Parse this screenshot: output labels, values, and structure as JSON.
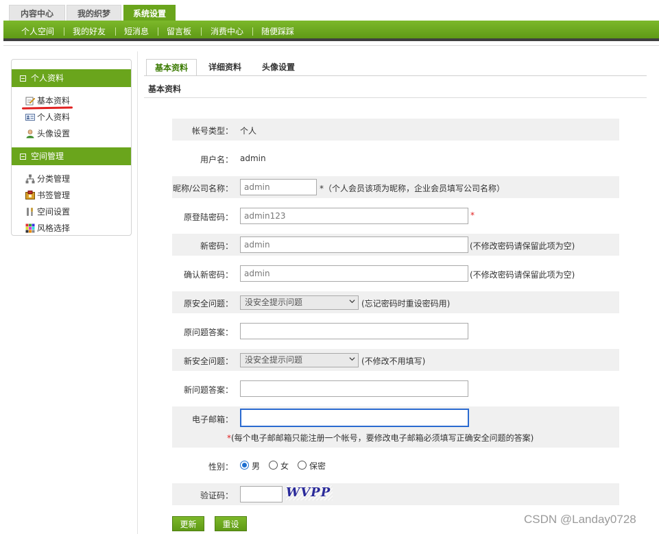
{
  "top_tabs": [
    "内容中心",
    "我的织梦",
    "系统设置"
  ],
  "subnav": [
    "个人空间",
    "我的好友",
    "短消息",
    "留言板",
    "消费中心",
    "随便踩踩"
  ],
  "sidebar": {
    "group1": "个人资料",
    "group1_items": [
      "基本资料",
      "个人资料",
      "头像设置"
    ],
    "group2": "空间管理",
    "group2_items": [
      "分类管理",
      "书签管理",
      "空间设置",
      "风格选择"
    ]
  },
  "content_tabs": [
    "基本资料",
    "详细资料",
    "头像设置"
  ],
  "section_title": "基本资料",
  "form": {
    "account_type_label": "帐号类型：",
    "account_type_value": "个人",
    "username_label": "用户名：",
    "username_value": "admin",
    "nickname_label": "昵称/公司名称：",
    "nickname_value": "admin",
    "nickname_hint": "*（个人会员该项为昵称，企业会员填写公司名称）",
    "old_password_label": "原登陆密码：",
    "old_password_value": "admin123",
    "required_mark": "*",
    "new_password_label": "新密码：",
    "new_password_value": "admin",
    "new_password_hint": "(不修改密码请保留此项为空)",
    "confirm_password_label": "确认新密码：",
    "confirm_password_value": "admin",
    "confirm_password_hint": "(不修改密码请保留此项为空)",
    "old_question_label": "原安全问题：",
    "old_question_value": "没安全提示问题",
    "old_question_hint": "(忘记密码时重设密码用)",
    "old_answer_label": "原问题答案：",
    "old_answer_value": "",
    "new_question_label": "新安全问题：",
    "new_question_value": "没安全提示问题",
    "new_question_hint": "(不修改不用填写)",
    "new_answer_label": "新问题答案：",
    "new_answer_value": "",
    "email_label": "电子邮箱：",
    "email_value": "",
    "email_hint": "(每个电子邮邮箱只能注册一个帐号，要修改电子邮箱必须填写正确安全问题的答案)",
    "gender_label": "性别：",
    "gender_options": [
      "男",
      "女",
      "保密"
    ],
    "gender_selected": "男",
    "captcha_label": "验证码：",
    "captcha_value": "",
    "captcha_image_text": "WVPP"
  },
  "buttons": {
    "update": "更新",
    "reset": "重设"
  },
  "watermark": "CSDN @Landay0728",
  "colors": {
    "accent_green": "#6aa51c",
    "dark_bar": "#3f3f3f",
    "required_red": "#e02020",
    "focus_blue": "#2a6ad0"
  }
}
